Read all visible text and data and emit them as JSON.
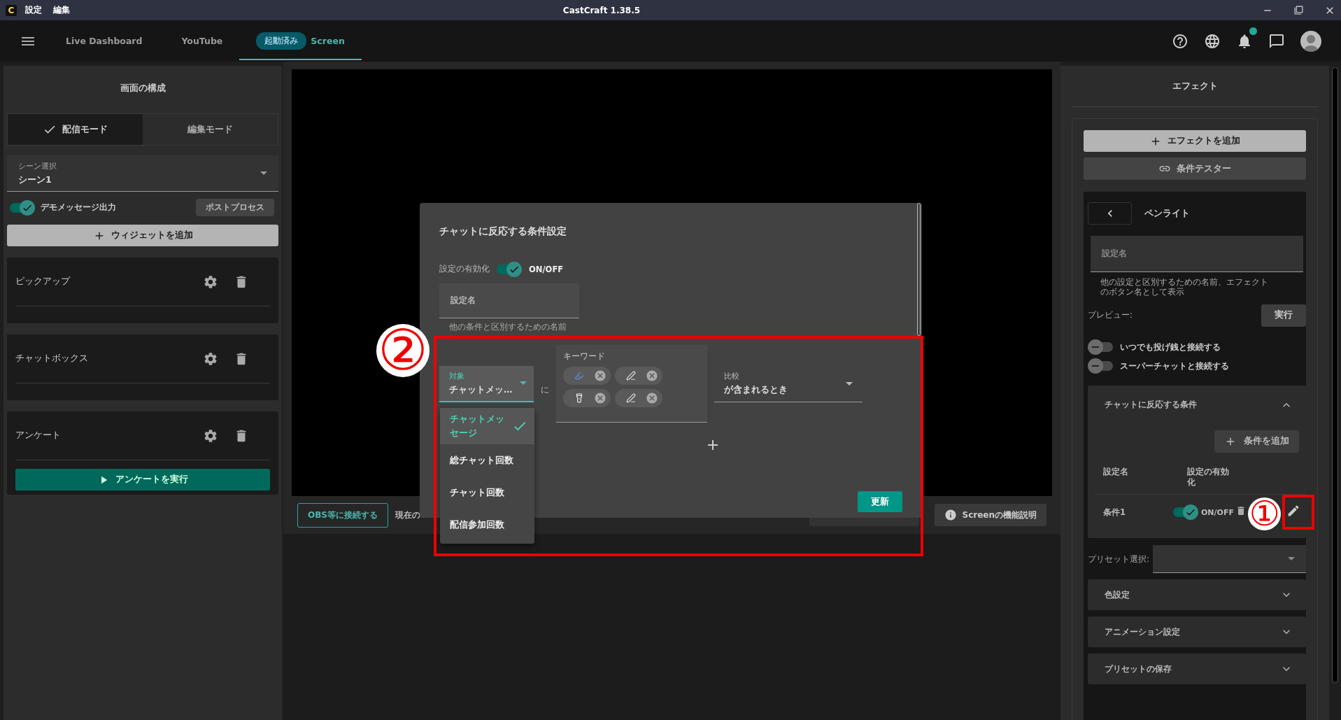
{
  "titlebar": {
    "logo": "C",
    "menus": [
      "設定",
      "編集"
    ],
    "title": "CastCraft 1.38.5"
  },
  "nav": {
    "tabs": [
      {
        "label": "Live Dashboard",
        "selected": false
      },
      {
        "label": "YouTube",
        "selected": false
      },
      {
        "label": "Screen",
        "badge": "起動済み",
        "selected": true
      }
    ]
  },
  "left_panel": {
    "title": "画面の構成",
    "modes": [
      {
        "label": "配信モード",
        "selected": true
      },
      {
        "label": "編集モード",
        "selected": false
      }
    ],
    "scene_select": {
      "label": "シーン選択",
      "value": "シーン1"
    },
    "demo_toggle": {
      "label": "デモメッセージ出力",
      "on": true
    },
    "postprocess_button": "ポストプロセス",
    "add_widget_button": "ウィジェットを追加",
    "widgets": [
      {
        "name": "ピックアップ"
      },
      {
        "name": "チャットボックス"
      },
      {
        "name": "アンケート",
        "action": "アンケートを実行"
      }
    ]
  },
  "preview": {
    "obs_button": "OBS等に接続する",
    "status_text": "現在の",
    "help_button": "Screenの機能説明"
  },
  "dialog": {
    "title": "チャットに反応する条件設定",
    "enable": {
      "label": "設定の有効化",
      "on": true,
      "state_text": "ON/OFF"
    },
    "name_field": {
      "placeholder": "設定名",
      "helper": "他の条件と区別するための名前"
    },
    "target_select": {
      "label": "対象",
      "value": "チャットメッ…"
    },
    "particle": "に",
    "target_options": [
      {
        "label": "チャットメッセージ",
        "selected": true
      },
      {
        "label": "総チャット回数",
        "selected": false
      },
      {
        "label": "チャット回数",
        "selected": false
      },
      {
        "label": "配信参加回数",
        "selected": false
      }
    ],
    "keywords": {
      "label": "キーワード",
      "chips": [
        {
          "kind": "highlighter"
        },
        {
          "kind": "pen"
        },
        {
          "kind": "flashlight"
        },
        {
          "kind": "pen"
        }
      ]
    },
    "compare_select": {
      "label": "比較",
      "value": "が含まれるとき"
    },
    "update_button": "更新"
  },
  "effect_panel": {
    "title": "エフェクト",
    "add_button": "エフェクトを追加",
    "tester_button": "条件テスター",
    "effect_name": "ペンライト",
    "name_field": {
      "placeholder": "設定名",
      "helper": "他の設定と区別するための名前、エフェクトのボタン名として表示"
    },
    "preview_label": "プレビュー:",
    "run_button": "実行",
    "toggles": [
      {
        "label": "いつでも投げ銭と接続する",
        "on": false
      },
      {
        "label": "スーパーチャットと接続する",
        "on": false
      }
    ],
    "conditions": {
      "title": "チャットに反応する条件",
      "expanded": true,
      "add_button": "条件を追加",
      "columns": [
        "設定名",
        "設定の有効化"
      ],
      "rows": [
        {
          "name": "条件1",
          "on": true,
          "state_text": "ON/OFF"
        }
      ]
    },
    "preset_label": "プリセット選択:",
    "sections": [
      {
        "title": "色設定",
        "expanded": false
      },
      {
        "title": "アニメーション設定",
        "expanded": false
      },
      {
        "title": "プリセットの保存",
        "expanded": false
      }
    ]
  },
  "annotations": [
    {
      "label": "②",
      "kind": "circle"
    },
    {
      "label": "①",
      "kind": "circle"
    },
    {
      "kind": "frame"
    },
    {
      "kind": "frame"
    }
  ]
}
